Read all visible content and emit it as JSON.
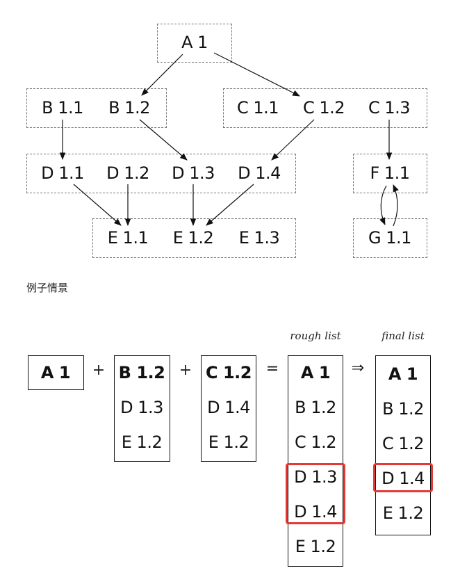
{
  "graph": {
    "levels": [
      [
        "A 1"
      ],
      [
        "B 1.1",
        "B 1.2",
        "C 1.1",
        "C 1.2",
        "C 1.3"
      ],
      [
        "D 1.1",
        "D 1.2",
        "D 1.3",
        "D 1.4",
        "F 1.1"
      ],
      [
        "E 1.1",
        "E 1.2",
        "E 1.3",
        "G 1.1"
      ]
    ]
  },
  "caption": "例子情景",
  "merge": {
    "list_a": [
      "A 1"
    ],
    "list_b": [
      "B 1.2",
      "D 1.3",
      "E 1.2"
    ],
    "list_c": [
      "C 1.2",
      "D 1.4",
      "E 1.2"
    ],
    "plus": "+",
    "equals": "=",
    "implies": "⇒",
    "rough_title": "rough list",
    "rough": [
      "A 1",
      "B 1.2",
      "C 1.2",
      "D 1.3",
      "D 1.4",
      "E 1.2"
    ],
    "final_title": "final list",
    "final": [
      "A 1",
      "B 1.2",
      "C 1.2",
      "D 1.4",
      "E 1.2"
    ]
  }
}
